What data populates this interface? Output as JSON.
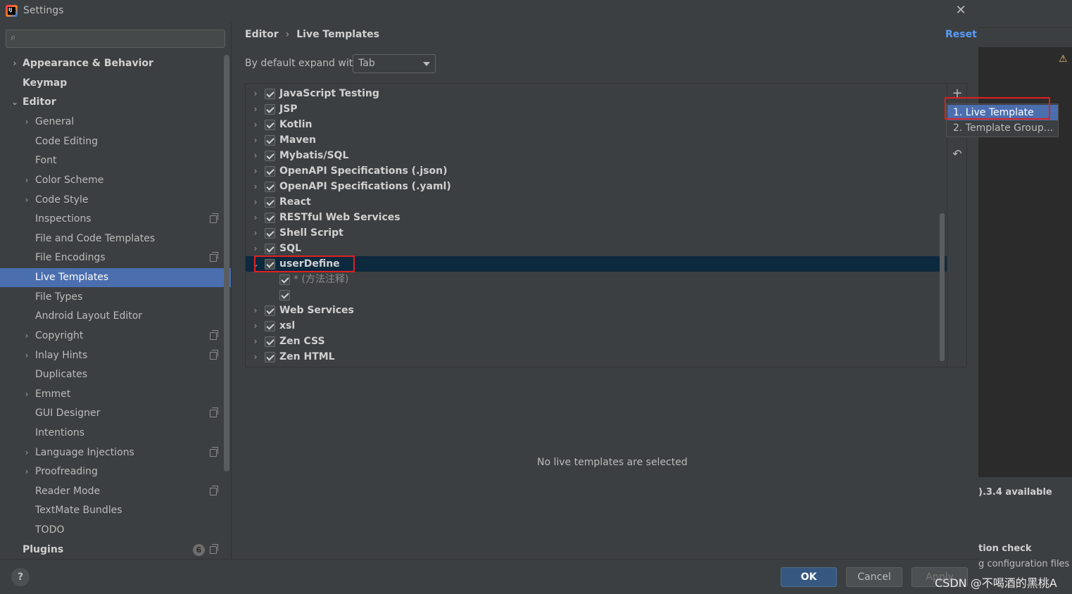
{
  "window": {
    "title": "Settings",
    "app_icon_text": "IJ"
  },
  "sidebar": {
    "search_placeholder": "",
    "items": [
      {
        "label": "Appearance & Behavior",
        "bold": true
      },
      {
        "label": "Keymap",
        "bold": true
      },
      {
        "label": "Editor",
        "bold": true
      },
      {
        "label": "General"
      },
      {
        "label": "Code Editing"
      },
      {
        "label": "Font"
      },
      {
        "label": "Color Scheme"
      },
      {
        "label": "Code Style"
      },
      {
        "label": "Inspections"
      },
      {
        "label": "File and Code Templates"
      },
      {
        "label": "File Encodings"
      },
      {
        "label": "Live Templates",
        "selected": true
      },
      {
        "label": "File Types"
      },
      {
        "label": "Android Layout Editor"
      },
      {
        "label": "Copyright"
      },
      {
        "label": "Inlay Hints"
      },
      {
        "label": "Duplicates"
      },
      {
        "label": "Emmet"
      },
      {
        "label": "GUI Designer"
      },
      {
        "label": "Intentions"
      },
      {
        "label": "Language Injections"
      },
      {
        "label": "Proofreading"
      },
      {
        "label": "Reader Mode"
      },
      {
        "label": "TextMate Bundles"
      },
      {
        "label": "TODO"
      },
      {
        "label": "Plugins",
        "bold": true,
        "badge": "6"
      }
    ]
  },
  "main": {
    "breadcrumb": [
      "Editor",
      "Live Templates"
    ],
    "reset_label": "Reset",
    "expand_label": "By default expand with",
    "expand_value": "Tab",
    "templates": [
      {
        "label": "JavaScript Testing",
        "checked": true
      },
      {
        "label": "JSP",
        "checked": true
      },
      {
        "label": "Kotlin",
        "checked": true
      },
      {
        "label": "Maven",
        "checked": true
      },
      {
        "label": "Mybatis/SQL",
        "checked": true
      },
      {
        "label": "OpenAPI Specifications (.json)",
        "checked": true
      },
      {
        "label": "OpenAPI Specifications (.yaml)",
        "checked": true
      },
      {
        "label": "React",
        "checked": true
      },
      {
        "label": "RESTful Web Services",
        "checked": true
      },
      {
        "label": "Shell Script",
        "checked": true
      },
      {
        "label": "SQL",
        "checked": true
      },
      {
        "label": "userDefine",
        "checked": true,
        "expanded": true,
        "selected": true
      },
      {
        "label": "* (方法注释)",
        "checked": true,
        "child": true
      },
      {
        "label": "",
        "checked": true,
        "child": true
      },
      {
        "label": "Web Services",
        "checked": true
      },
      {
        "label": "xsl",
        "checked": true
      },
      {
        "label": "Zen CSS",
        "checked": true
      },
      {
        "label": "Zen HTML",
        "checked": true
      }
    ],
    "empty_message": "No live templates are selected"
  },
  "popup": {
    "items": [
      "1. Live Template",
      "2. Template Group..."
    ]
  },
  "buttons": {
    "ok": "OK",
    "cancel": "Cancel",
    "apply": "Apply",
    "help": "?"
  },
  "background_ide": {
    "notif1_title": ").3.4 available",
    "notif2_title": "tion check",
    "notif2_body": "g configuration files t"
  },
  "watermark": "CSDN @不喝酒的黑桃A"
}
